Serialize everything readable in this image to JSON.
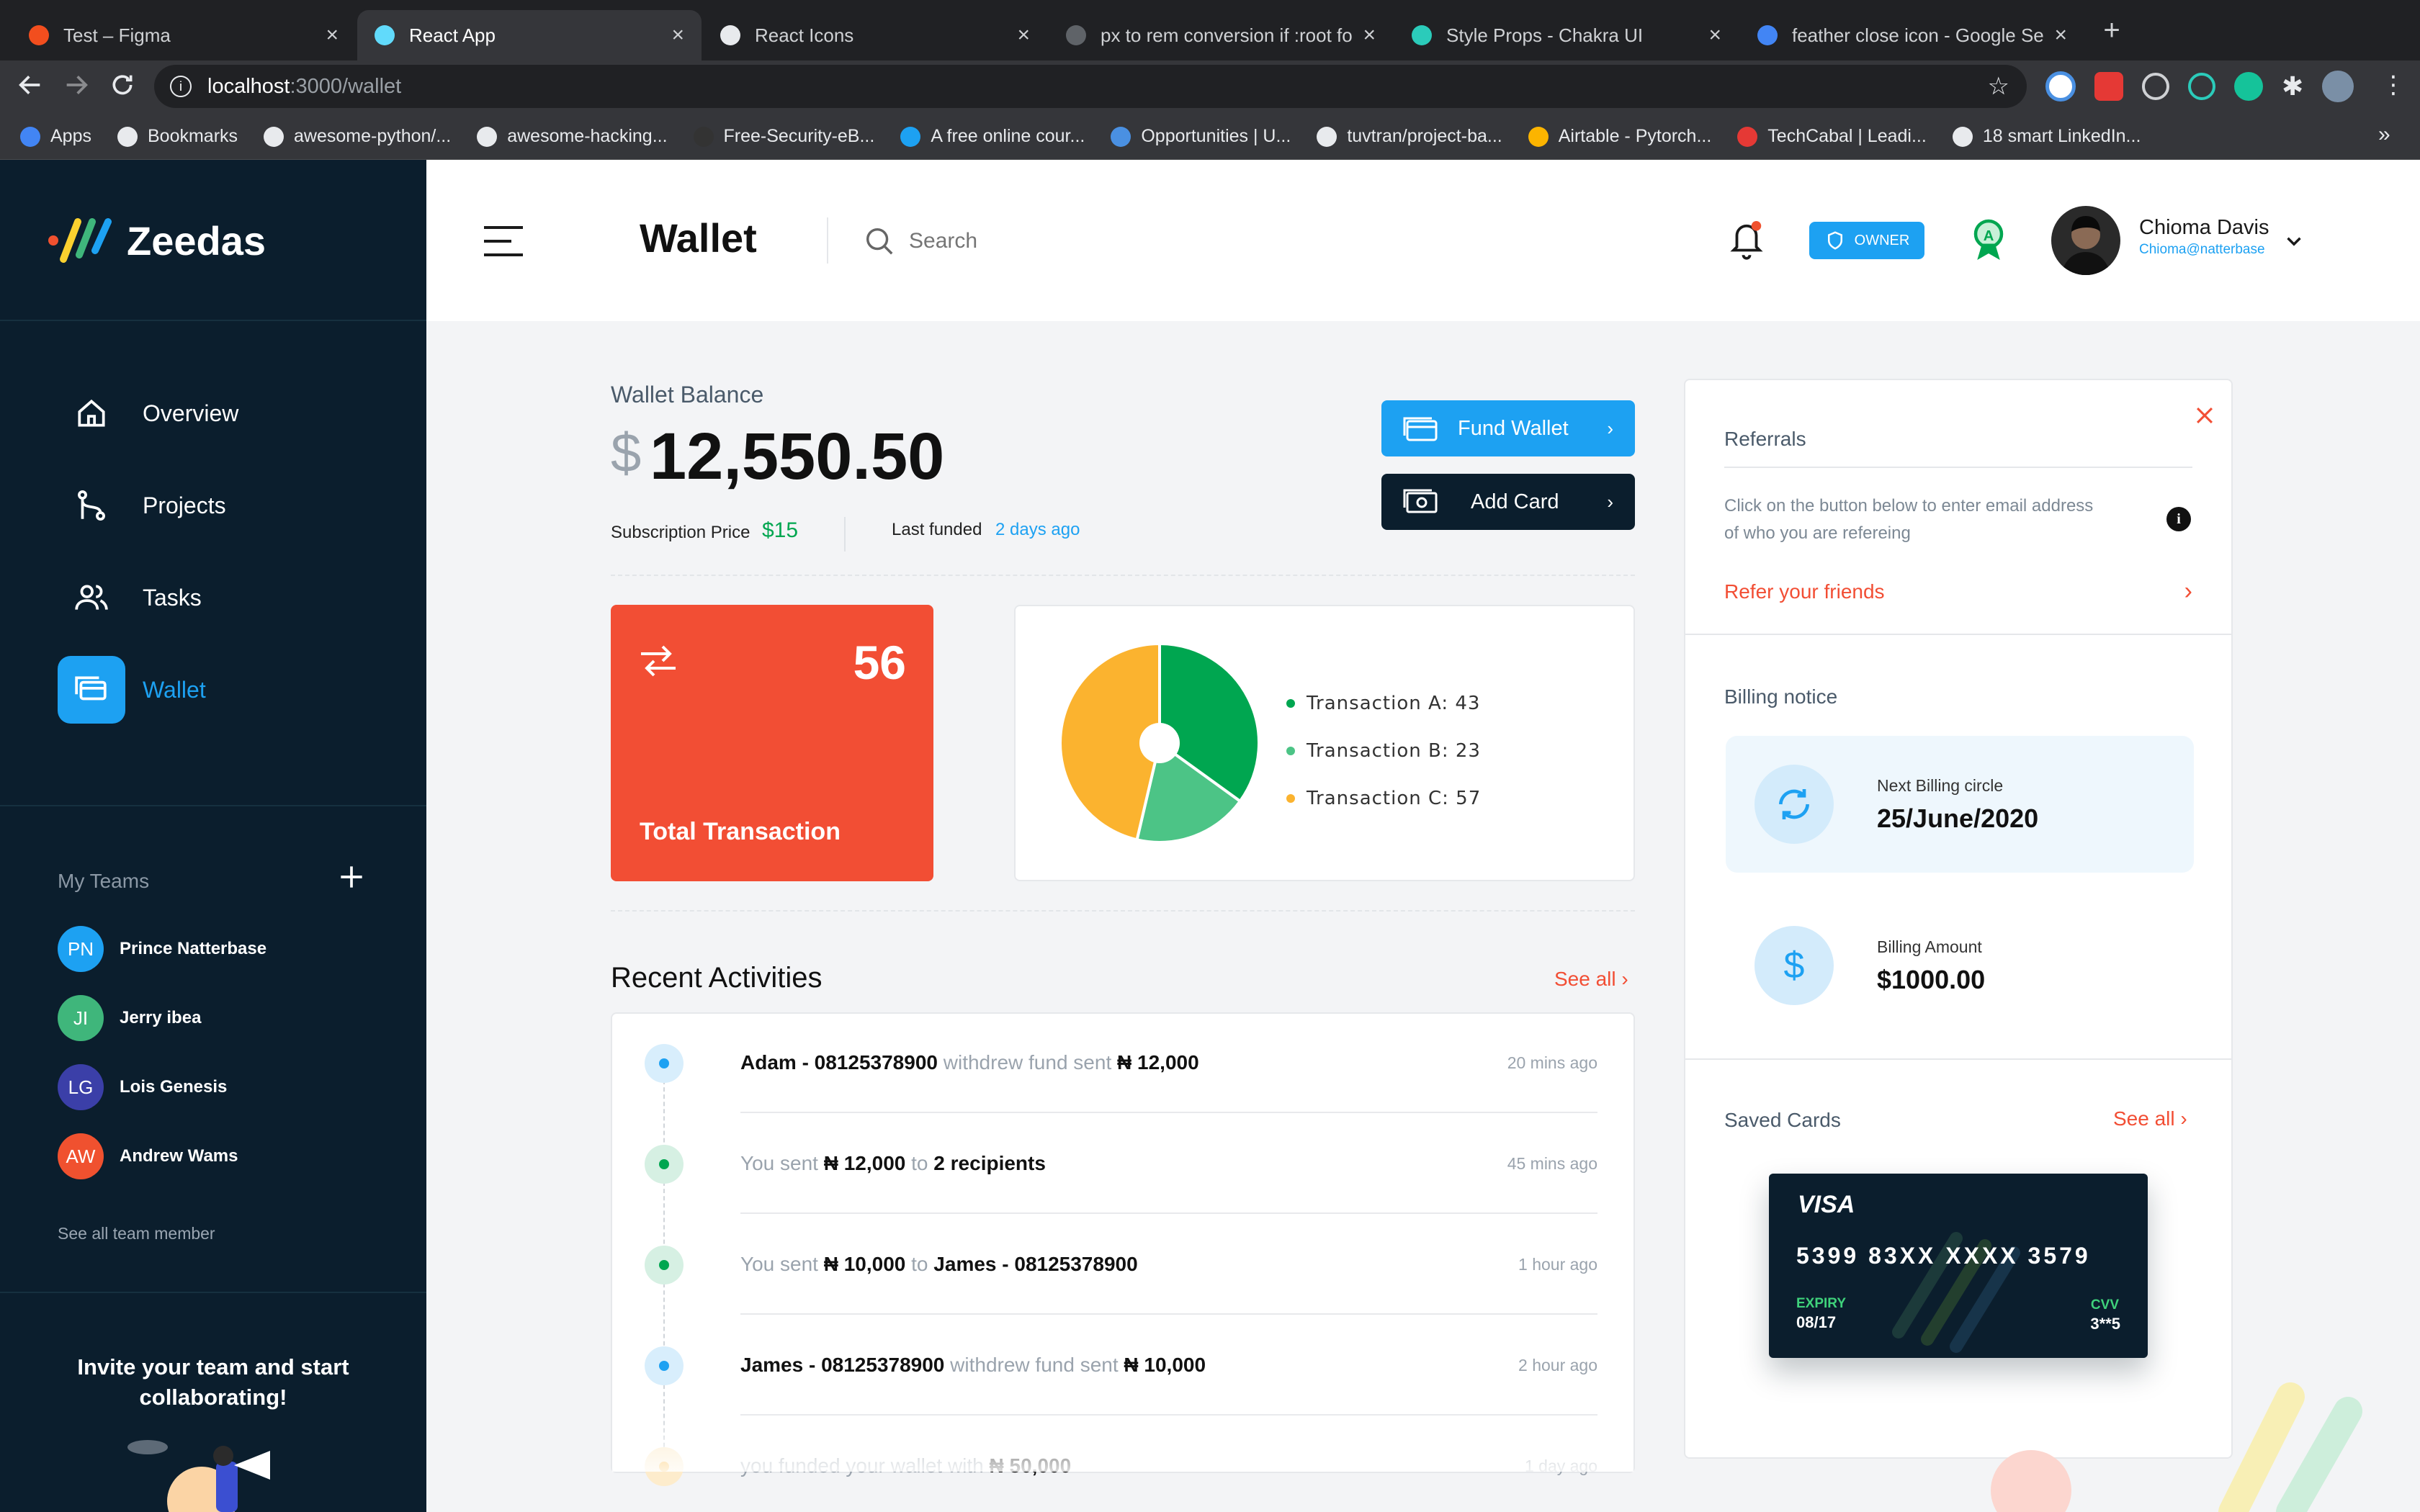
{
  "browser": {
    "tabs": [
      {
        "title": "Test – Figma",
        "active": false,
        "icon": "figma-icon",
        "color": "#f24e1e"
      },
      {
        "title": "React App",
        "active": true,
        "icon": "react-icon",
        "color": "#61dafb"
      },
      {
        "title": "React Icons",
        "active": false,
        "icon": "react-icons-icon",
        "color": "#e8eaed"
      },
      {
        "title": "px to rem conversion if :root fo",
        "active": false,
        "icon": "globe-icon",
        "color": "#5f6368"
      },
      {
        "title": "Style Props - Chakra UI",
        "active": false,
        "icon": "chakra-icon",
        "color": "#2bcbba"
      },
      {
        "title": "feather close icon - Google Se",
        "active": false,
        "icon": "google-icon",
        "color": "#4285f4"
      }
    ],
    "url_host": "localhost",
    "url_path": ":3000/wallet",
    "bookmarks": [
      {
        "label": "Apps",
        "icon": "apps-grid-icon"
      },
      {
        "label": "Bookmarks",
        "icon": "star-icon"
      },
      {
        "label": "awesome-python/...",
        "icon": "github-icon"
      },
      {
        "label": "awesome-hacking...",
        "icon": "github-icon"
      },
      {
        "label": "Free-Security-eB...",
        "icon": "github-icon"
      },
      {
        "label": "A free online cour...",
        "icon": "course-icon"
      },
      {
        "label": "Opportunities | U...",
        "icon": "un-icon"
      },
      {
        "label": "tuvtran/project-ba...",
        "icon": "github-icon"
      },
      {
        "label": "Airtable - Pytorch...",
        "icon": "airtable-icon"
      },
      {
        "label": "TechCabal | Leadi...",
        "icon": "techcabal-icon"
      },
      {
        "label": "18 smart LinkedIn...",
        "icon": "link-icon"
      }
    ],
    "more_bookmarks": "»"
  },
  "brand": {
    "name": "Zeedas"
  },
  "nav": [
    {
      "label": "Overview",
      "icon": "home-icon",
      "active": false
    },
    {
      "label": "Projects",
      "icon": "git-branch-icon",
      "active": false
    },
    {
      "label": "Tasks",
      "icon": "users-icon",
      "active": false
    },
    {
      "label": "Wallet",
      "icon": "wallet-icon",
      "active": true
    }
  ],
  "teams": {
    "heading": "My Teams",
    "members": [
      {
        "initials": "PN",
        "name": "Prince Natterbase",
        "color": "#1da1f2"
      },
      {
        "initials": "JI",
        "name": "Jerry ibea",
        "color": "#3fb67b"
      },
      {
        "initials": "LG",
        "name": "Lois Genesis",
        "color": "#3b3fa8"
      },
      {
        "initials": "AW",
        "name": "Andrew Wams",
        "color": "#f0512f"
      }
    ],
    "see_all": "See all team member"
  },
  "invite": {
    "line1": "Invite your team and start",
    "line2": "collaborating!"
  },
  "header": {
    "title": "Wallet",
    "search_placeholder": "Search",
    "badge": "OWNER",
    "user_name": "Chioma Davis",
    "user_email": "Chioma@natterbase"
  },
  "balance": {
    "label": "Wallet Balance",
    "currency": "$",
    "amount": "12,550.50",
    "sub_price_label": "Subscription Price",
    "sub_price": "$15",
    "last_funded_label": "Last funded",
    "last_funded": "2 days ago",
    "fund_button": "Fund Wallet",
    "add_card_button": "Add Card"
  },
  "total": {
    "count": "56",
    "label": "Total Transaction"
  },
  "chart_data": {
    "type": "pie",
    "categories": [
      "Transaction A",
      "Transaction B",
      "Transaction C"
    ],
    "values": [
      43,
      23,
      57
    ],
    "legend": [
      "Transaction A: 43",
      "Transaction B: 23",
      "Transaction C: 57"
    ],
    "colors": [
      "#00a650",
      "#4cc486",
      "#fbb32f"
    ],
    "legend_placement": "right"
  },
  "activities": {
    "heading": "Recent Activities",
    "see_all": "See all",
    "items": [
      {
        "parts": [
          [
            "Adam - 08125378900",
            "b"
          ],
          [
            " withdrew fund sent ",
            "m"
          ],
          [
            "₦ 12,000",
            "b"
          ]
        ],
        "time": "20 mins ago",
        "dot": "#1da1f2",
        "ring": "#d8eefc"
      },
      {
        "parts": [
          [
            "You sent ",
            "m"
          ],
          [
            "₦ 12,000",
            "b"
          ],
          [
            " to ",
            "m"
          ],
          [
            "2 recipients",
            "b"
          ]
        ],
        "time": "45 mins ago",
        "dot": "#00a650",
        "ring": "#d6f0e3"
      },
      {
        "parts": [
          [
            "You sent ",
            "m"
          ],
          [
            "₦ 10,000",
            "b"
          ],
          [
            " to ",
            "m"
          ],
          [
            "James - 08125378900",
            "b"
          ]
        ],
        "time": "1 hour ago",
        "dot": "#00a650",
        "ring": "#d6f0e3"
      },
      {
        "parts": [
          [
            "James - 08125378900",
            "b"
          ],
          [
            " withdrew fund sent ",
            "m"
          ],
          [
            "₦ 10,000",
            "b"
          ]
        ],
        "time": "2 hour ago",
        "dot": "#1da1f2",
        "ring": "#d8eefc"
      },
      {
        "parts": [
          [
            "you funded your wallet with ",
            "m"
          ],
          [
            "₦ 50,000",
            "b"
          ]
        ],
        "time": "1 day ago",
        "dot": "#fbb32f",
        "ring": "#fdeccc"
      }
    ]
  },
  "referrals": {
    "heading": "Referrals",
    "text_line1": "Click on the button below to enter email address",
    "text_line2": "of who you are refereing",
    "link": "Refer your friends"
  },
  "billing": {
    "heading": "Billing notice",
    "next_label": "Next Billing circle",
    "next_value": "25/June/2020",
    "amount_label": "Billing Amount",
    "amount_value": "$1000.00"
  },
  "saved_cards": {
    "heading": "Saved Cards",
    "see_all": "See all",
    "brand": "VISA",
    "number": "5399 83XX XXXX 3579",
    "expiry_label": "EXPIRY",
    "expiry": "08/17",
    "cvv_label": "CVV",
    "cvv": "3**5"
  }
}
